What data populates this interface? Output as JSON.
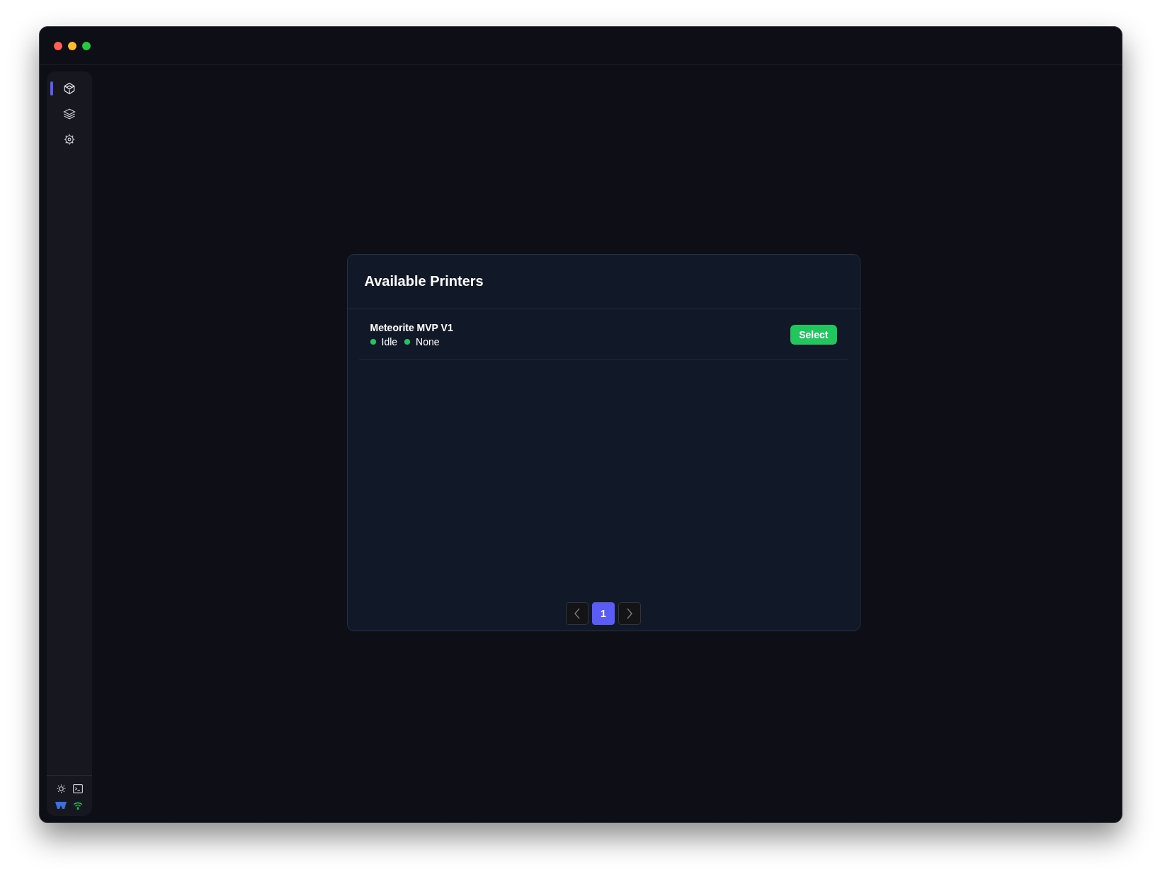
{
  "sidebar": {
    "nav_items": [
      {
        "kind": "cube",
        "selected": true
      },
      {
        "kind": "layers",
        "selected": false
      },
      {
        "kind": "gear",
        "selected": false
      }
    ]
  },
  "panel": {
    "title": "Available Printers",
    "printers": [
      {
        "name": "Meteorite MVP V1",
        "statuses": [
          {
            "label": "Idle",
            "color": "#22c55e"
          },
          {
            "label": "None",
            "color": "#22c55e"
          }
        ],
        "action": "Select"
      }
    ],
    "pagination": {
      "pages": [
        {
          "label": "1",
          "selected": true
        }
      ]
    }
  }
}
